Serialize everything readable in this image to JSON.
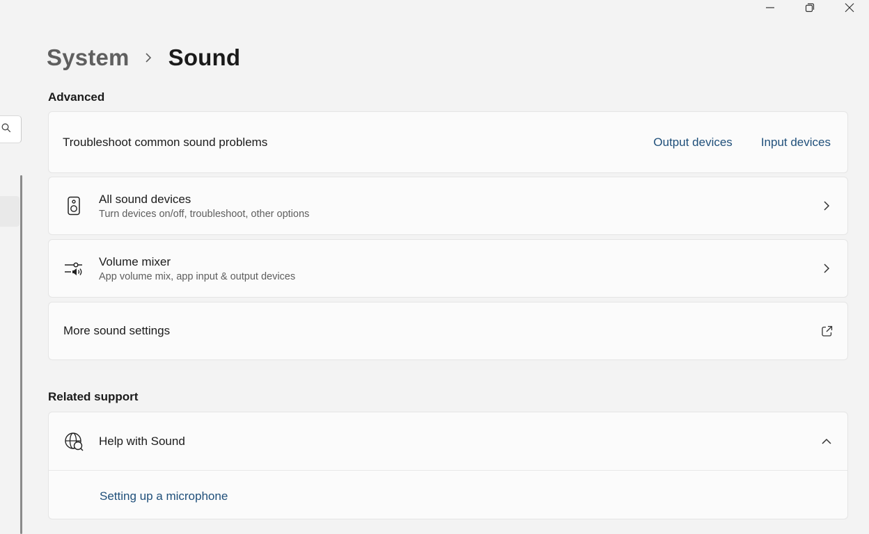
{
  "window": {
    "caption": {
      "minimize_icon": "minimize-icon",
      "maximize_icon": "restore-icon",
      "close_icon": "close-icon"
    }
  },
  "nav": {
    "search_icon": "search-icon"
  },
  "breadcrumb": {
    "parent": "System",
    "separator_icon": "chevron-right-icon",
    "current": "Sound"
  },
  "advanced": {
    "heading": "Advanced",
    "troubleshoot": {
      "label": "Troubleshoot common sound problems",
      "output_link": "Output devices",
      "input_link": "Input devices"
    },
    "all_sound_devices": {
      "title": "All sound devices",
      "desc": "Turn devices on/off, troubleshoot, other options",
      "icon": "speaker-icon"
    },
    "volume_mixer": {
      "title": "Volume mixer",
      "desc": "App volume mix, app input & output devices",
      "icon": "volume-mixer-icon"
    },
    "more_sound_settings": {
      "title": "More sound settings",
      "icon": "external-link-icon"
    }
  },
  "related_support": {
    "heading": "Related support",
    "help": {
      "title": "Help with Sound",
      "icon": "globe-help-icon",
      "expand_icon": "chevron-up-icon",
      "links": [
        "Setting up a microphone"
      ]
    }
  },
  "colors": {
    "background": "#f3f3f3",
    "card": "#fbfbfb",
    "link": "#1f4f7a"
  }
}
